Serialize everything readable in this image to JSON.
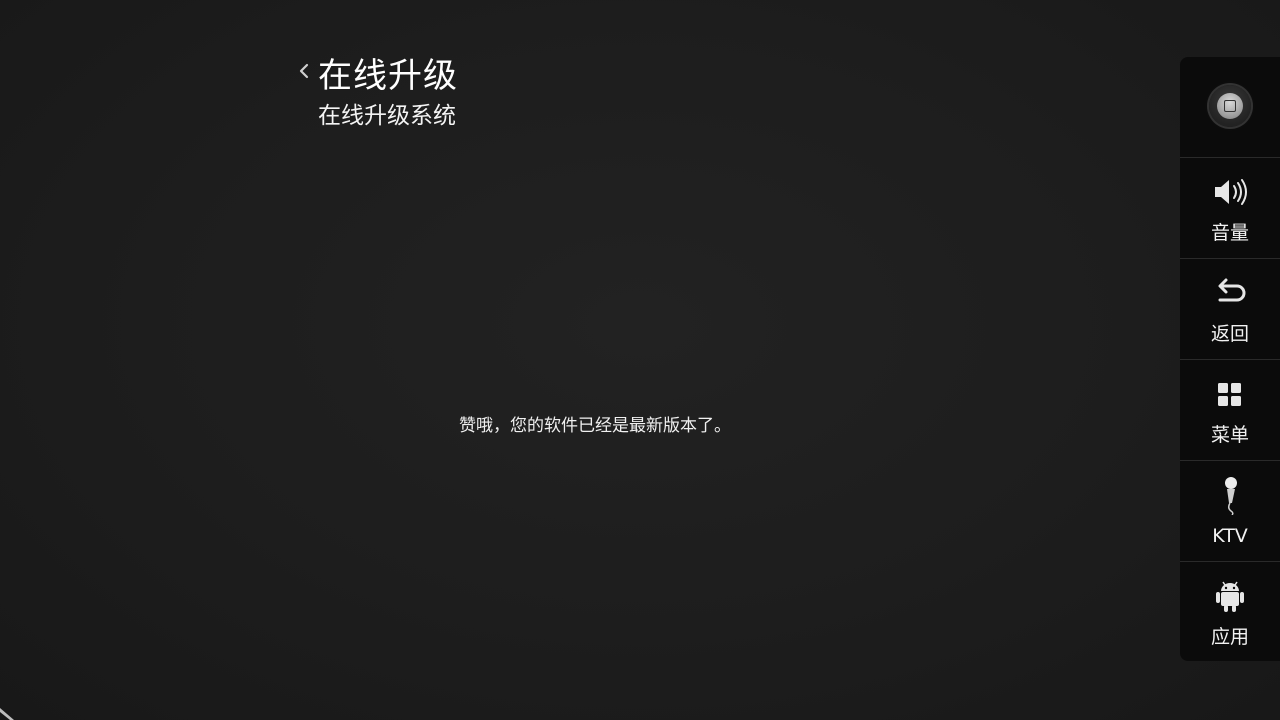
{
  "header": {
    "title": "在线升级",
    "subtitle": "在线升级系统"
  },
  "message": "赞哦，您的软件已经是最新版本了。",
  "side_panel": {
    "items": [
      {
        "label": "",
        "icon": "home-icon"
      },
      {
        "label": "音量",
        "icon": "volume-icon"
      },
      {
        "label": "返回",
        "icon": "back-icon"
      },
      {
        "label": "菜单",
        "icon": "menu-grid-icon"
      },
      {
        "label": "KTV",
        "icon": "microphone-icon"
      },
      {
        "label": "应用",
        "icon": "android-icon"
      }
    ]
  },
  "colors": {
    "background": "#1c1c1c",
    "panel": "#0b0b0b",
    "text": "#f2f2f2"
  }
}
